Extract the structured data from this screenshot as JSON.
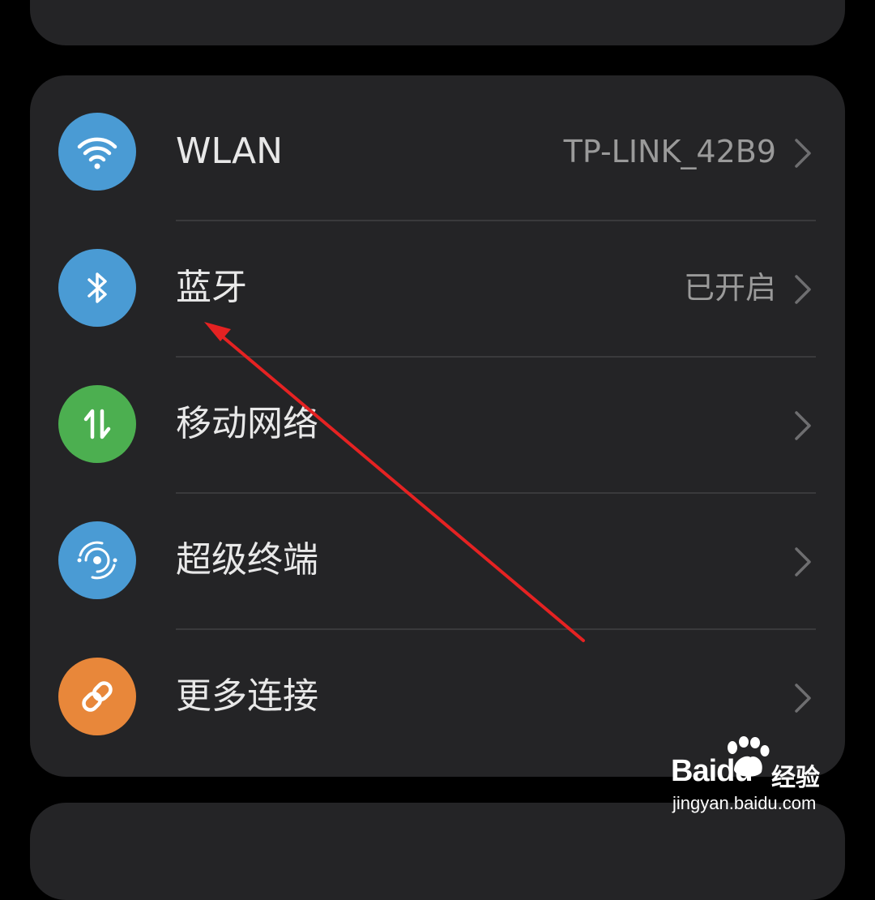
{
  "settings_group": {
    "items": [
      {
        "label": "WLAN",
        "value": "TP-LINK_42B9",
        "icon": "wifi-icon",
        "icon_color": "#4a9bd4"
      },
      {
        "label": "蓝牙",
        "value": "已开启",
        "icon": "bluetooth-icon",
        "icon_color": "#4a9bd4"
      },
      {
        "label": "移动网络",
        "value": "",
        "icon": "mobile-data-icon",
        "icon_color": "#4caf50"
      },
      {
        "label": "超级终端",
        "value": "",
        "icon": "super-device-icon",
        "icon_color": "#4a9bd4"
      },
      {
        "label": "更多连接",
        "value": "",
        "icon": "link-icon",
        "icon_color": "#e8873a"
      }
    ]
  },
  "annotation": {
    "color": "#e52222"
  },
  "watermark": {
    "logo": "Baidu",
    "product": "经验",
    "url": "jingyan.baidu.com"
  },
  "colors": {
    "background": "#000000",
    "card": "#242426",
    "divider": "#3a3a3c"
  }
}
